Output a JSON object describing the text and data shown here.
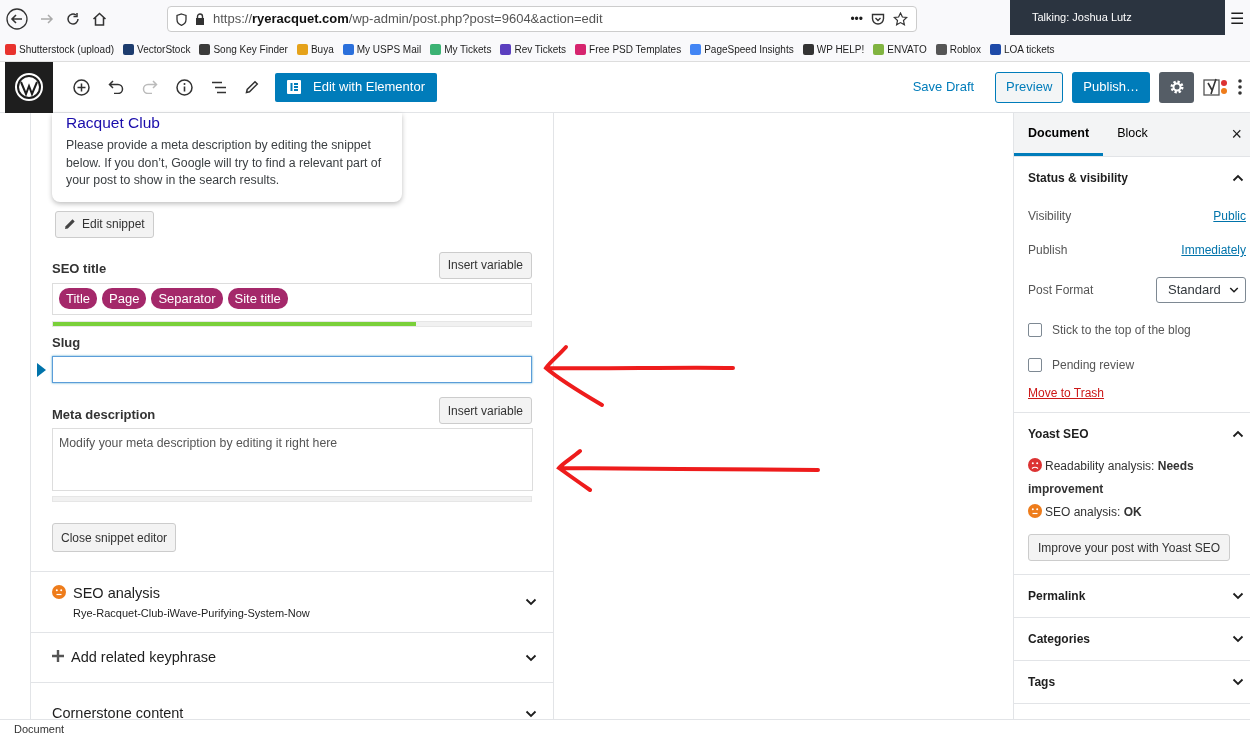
{
  "browser": {
    "url_scheme": "https://",
    "url_domain": "ryeracquet.com",
    "url_path": "/wp-admin/post.php?post=9604&action=edit",
    "more": "•••",
    "menu": "☰"
  },
  "notification": {
    "text": "Talking: Joshua Lutz"
  },
  "bookmarks": [
    {
      "label": "Shutterstock (upload)",
      "color": "#e8322d"
    },
    {
      "label": "VectorStock",
      "color": "#1d3c6e"
    },
    {
      "label": "Song Key Finder",
      "color": "#3a3a3a"
    },
    {
      "label": "Buya",
      "color": "#e5a21b"
    },
    {
      "label": "My USPS Mail",
      "color": "#2a6fdb"
    },
    {
      "label": "My Tickets",
      "color": "#3bb273"
    },
    {
      "label": "Rev Tickets",
      "color": "#5b3fbf"
    },
    {
      "label": "Free PSD Templates",
      "color": "#d6246e"
    },
    {
      "label": "PageSpeed Insights",
      "color": "#4285f4"
    },
    {
      "label": "WP HELP!",
      "color": "#333333"
    },
    {
      "label": "ENVATO",
      "color": "#81b441"
    },
    {
      "label": "Roblox",
      "color": "#555555"
    },
    {
      "label": "LOA tickets",
      "color": "#1e4aa8"
    }
  ],
  "toolbar": {
    "elementor_button": "Edit with Elementor",
    "save_draft": "Save Draft",
    "preview": "Preview",
    "publish": "Publish…",
    "settings_selected": true
  },
  "snippet": {
    "title": "Racquet Club",
    "description": "Please provide a meta description by editing the snippet below. If you don’t, Google will try to find a relevant part of your post to show in the search results.",
    "edit_button": "Edit snippet"
  },
  "seo_title": {
    "label": "SEO title",
    "insert_button": "Insert variable",
    "tags": [
      "Title",
      "Page",
      "Separator",
      "Site title"
    ],
    "level": 0.76
  },
  "slug": {
    "label": "Slug",
    "focused": true
  },
  "meta_description": {
    "label": "Meta description",
    "insert_button": "Insert variable",
    "placeholder": "Modify your meta description by editing it right here",
    "level": 0
  },
  "close_button": "Close snippet editor",
  "sections": [
    {
      "kind": "analysis",
      "title": "SEO analysis",
      "subtitle": "Rye-Racquet-Club-iWave-Purifying-System-Now",
      "color": "#ee7c1b",
      "expanded": false
    },
    {
      "kind": "add",
      "title": "Add related keyphrase",
      "expanded": false
    },
    {
      "kind": "plain",
      "title": "Cornerstone content",
      "expanded": false
    }
  ],
  "sidebar": {
    "tabs": [
      {
        "label": "Document",
        "selected": true
      },
      {
        "label": "Block",
        "selected": false
      }
    ],
    "close": "×",
    "status_panel": {
      "title": "Status & visibility",
      "expanded": true,
      "rows": [
        {
          "label": "Visibility",
          "value": "Public"
        },
        {
          "label": "Publish",
          "value": "Immediately"
        }
      ],
      "post_format": {
        "label": "Post Format",
        "value": "Standard"
      },
      "checks": [
        {
          "label": "Stick to the top of the blog",
          "checked": false
        },
        {
          "label": "Pending review",
          "checked": false
        }
      ],
      "trash": "Move to Trash"
    },
    "yoast_panel": {
      "title": "Yoast SEO",
      "expanded": true,
      "analyses": [
        {
          "text": "Readability analysis: **Needs improvement**",
          "color": "#dc3232"
        },
        {
          "text": "SEO analysis: **OK**",
          "color": "#ee7c1b"
        }
      ],
      "button": "Improve your post with Yoast SEO"
    },
    "panels": [
      {
        "title": "Permalink",
        "expanded": false
      },
      {
        "title": "Categories",
        "expanded": false
      },
      {
        "title": "Tags",
        "expanded": false
      }
    ]
  },
  "footer": "Document"
}
